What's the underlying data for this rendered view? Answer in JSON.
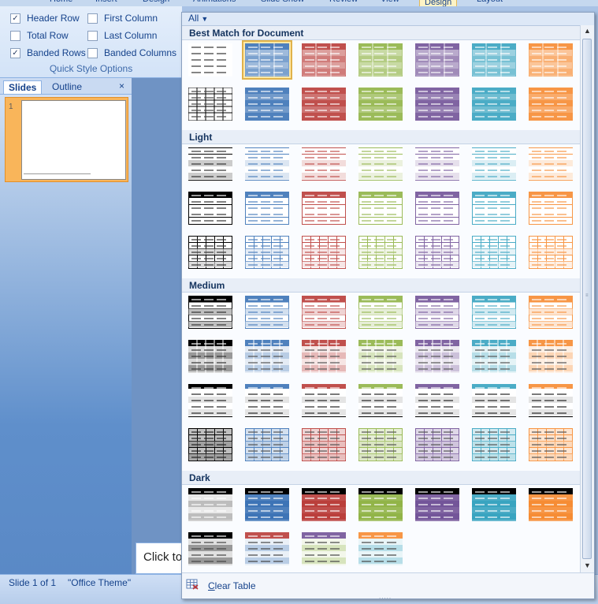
{
  "ribbon": {
    "tabs": [
      "Home",
      "Insert",
      "Design",
      "Animations",
      "Slide Show",
      "Review",
      "View",
      "Design",
      "Layout"
    ],
    "active_tab_index": 7,
    "options": [
      {
        "label": "Header Row",
        "checked": true
      },
      {
        "label": "First Column",
        "checked": false
      },
      {
        "label": "Total Row",
        "checked": false
      },
      {
        "label": "Last Column",
        "checked": false
      },
      {
        "label": "Banded Rows",
        "checked": true
      },
      {
        "label": "Banded Columns",
        "checked": false
      }
    ],
    "group_label": "Quick Style Options"
  },
  "left_pane": {
    "tab_slides": "Slides",
    "tab_outline": "Outline",
    "close_glyph": "×",
    "slide_number": "1"
  },
  "notes": {
    "text": "Click to"
  },
  "status": {
    "slide": "Slide 1 of 1",
    "theme": "\"Office Theme\""
  },
  "gallery": {
    "filter_label": "All",
    "sections": [
      {
        "title": "Best Match for Document",
        "rows": [
          {
            "style": "bm-plain",
            "count": 7
          },
          {
            "style": "bm-dark",
            "count": 7
          }
        ]
      },
      {
        "title": "Light",
        "rows": [
          {
            "style": "light1",
            "count": 7
          },
          {
            "style": "light2",
            "count": 7
          },
          {
            "style": "light3",
            "count": 7
          }
        ]
      },
      {
        "title": "Medium",
        "rows": [
          {
            "style": "med1",
            "count": 7
          },
          {
            "style": "med2",
            "count": 7
          },
          {
            "style": "med3",
            "count": 7
          },
          {
            "style": "med4",
            "count": 7
          }
        ]
      },
      {
        "title": "Dark",
        "rows": [
          {
            "style": "dark1",
            "count": 7
          },
          {
            "style": "dark2",
            "count": 4
          }
        ]
      }
    ],
    "selected_tile": {
      "section": 0,
      "row": 0,
      "col": 1
    },
    "accent_colors": [
      "#000000",
      "#4f81bd",
      "#c0504d",
      "#9bbb59",
      "#8064a2",
      "#4bacc6",
      "#f79646"
    ],
    "dark2_pairs": [
      [
        "#000000",
        "#000000"
      ],
      [
        "#c0504d",
        "#4f81bd"
      ],
      [
        "#8064a2",
        "#9bbb59"
      ],
      [
        "#f79646",
        "#4bacc6"
      ]
    ],
    "clear_label_underlined": "C",
    "clear_label_rest": "lear Table",
    "clear_icon": "clear-table-icon",
    "grip": "....."
  }
}
